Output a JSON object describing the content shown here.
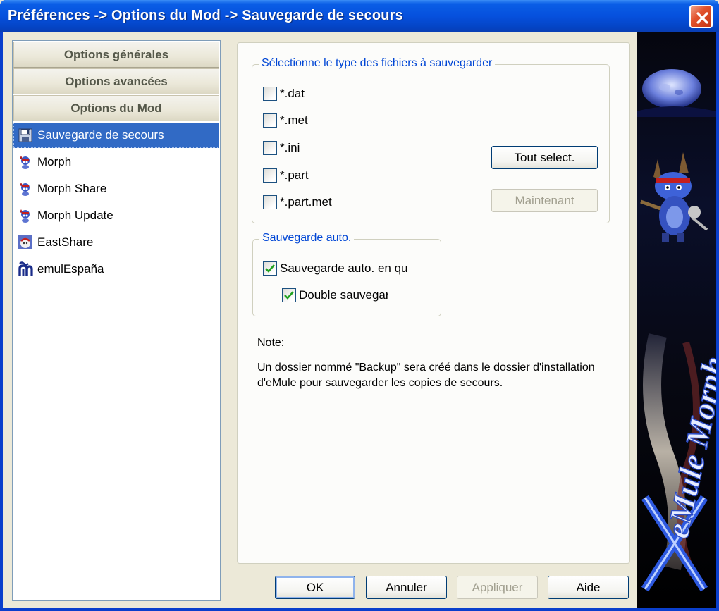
{
  "window": {
    "title": "Préférences -> Options du Mod -> Sauvegarde de secours"
  },
  "sidebar": {
    "categories": [
      {
        "label": "Options générales"
      },
      {
        "label": "Options avancées"
      },
      {
        "label": "Options du Mod"
      }
    ],
    "items": [
      {
        "label": "Sauvegarde de secours",
        "icon": "floppy-disk-icon",
        "selected": true
      },
      {
        "label": "Morph",
        "icon": "morph-mascot-icon"
      },
      {
        "label": "Morph Share",
        "icon": "morph-mascot-icon"
      },
      {
        "label": "Morph Update",
        "icon": "morph-mascot-icon"
      },
      {
        "label": "EastShare",
        "icon": "eastshare-icon"
      },
      {
        "label": "emulEspaña",
        "icon": "emulespana-icon"
      }
    ]
  },
  "filetypes": {
    "legend": "Sélectionne le type des fichiers à sauvegarder",
    "items": [
      {
        "label": "*.dat",
        "checked": false
      },
      {
        "label": "*.met",
        "checked": false
      },
      {
        "label": "*.ini",
        "checked": false
      },
      {
        "label": "*.part",
        "checked": false
      },
      {
        "label": "*.part.met",
        "checked": false
      }
    ],
    "select_all_label": "Tout select.",
    "now_label": "Maintenant"
  },
  "autobackup": {
    "legend": "Sauvegarde auto.",
    "auto_label": "Sauvegarde auto. en qu",
    "auto_checked": true,
    "double_label": "Double sauvegar",
    "double_checked": true
  },
  "note": {
    "title": "Note:",
    "body": "Un dossier nommé \"Backup\" sera créé dans le dossier d'installation d'eMule pour sauvegarder les copies de secours."
  },
  "buttons": {
    "ok": "OK",
    "cancel": "Annuler",
    "apply": "Appliquer",
    "help": "Aide"
  },
  "banner": {
    "text": "eMule Morph"
  },
  "colors": {
    "titlebar": "#0650dd",
    "selection": "#316ac5",
    "legend": "#0046d5",
    "close": "#e2522d"
  }
}
